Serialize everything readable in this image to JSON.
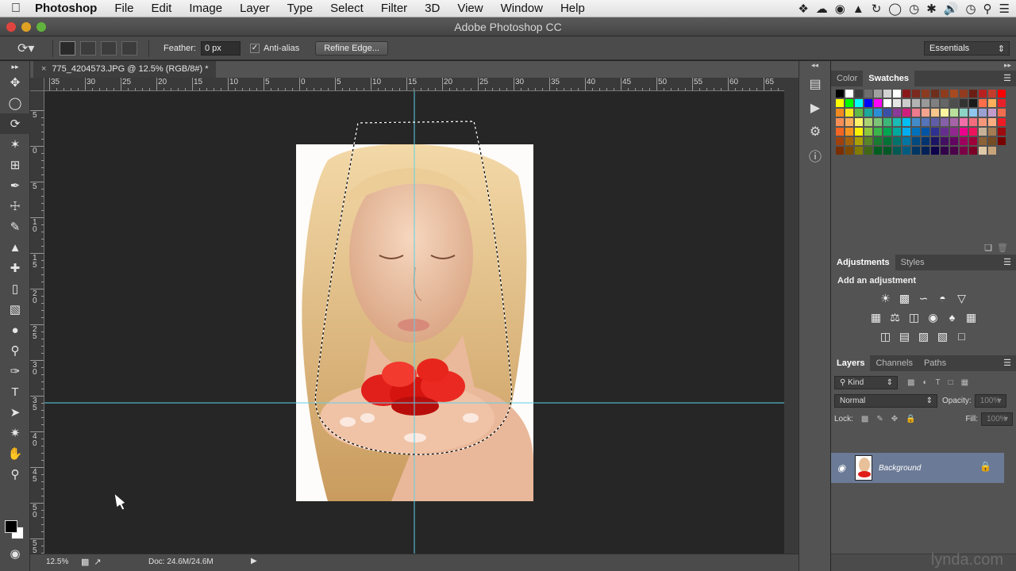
{
  "menubar": {
    "app_name": "Photoshop",
    "items": [
      "File",
      "Edit",
      "Image",
      "Layer",
      "Type",
      "Select",
      "Filter",
      "3D",
      "View",
      "Window",
      "Help"
    ]
  },
  "window": {
    "title": "Adobe Photoshop CC"
  },
  "options": {
    "feather_label": "Feather:",
    "feather_value": "0 px",
    "antialias_label": "Anti-alias",
    "antialias_checked": true,
    "refine_edge_label": "Refine Edge...",
    "workspace": "Essentials"
  },
  "document": {
    "tab_title": "775_4204573.JPG @ 12.5% (RGB/8#) *",
    "zoom": "12.5%",
    "doc_info": "Doc: 24.6M/24.6M"
  },
  "rulers": {
    "horizontal": [
      "35",
      "30",
      "25",
      "20",
      "15",
      "10",
      "5",
      "0",
      "5",
      "10",
      "15",
      "20",
      "25",
      "30",
      "35",
      "40",
      "45",
      "50",
      "55",
      "60",
      "65"
    ],
    "vertical": [
      "5",
      "0",
      "5",
      "1 0",
      "1 5",
      "2 0",
      "2 5",
      "3 0",
      "3 5",
      "4 0",
      "4 5",
      "5 0",
      "5 5"
    ]
  },
  "panels": {
    "color_tabs": [
      "Color",
      "Swatches"
    ],
    "adjust_tabs": [
      "Adjustments",
      "Styles"
    ],
    "adjust_title": "Add an adjustment",
    "layer_tabs": [
      "Layers",
      "Channels",
      "Paths"
    ],
    "kind_label": "Kind",
    "blend_mode": "Normal",
    "opacity_label": "Opacity:",
    "opacity_value": "100%",
    "lock_label": "Lock:",
    "fill_label": "Fill:",
    "fill_value": "100%",
    "layer_name": "Background"
  },
  "watermark": "lynda.com",
  "colors": {
    "accent_layer": "#6b7a96",
    "guide": "#5fd0e8"
  }
}
